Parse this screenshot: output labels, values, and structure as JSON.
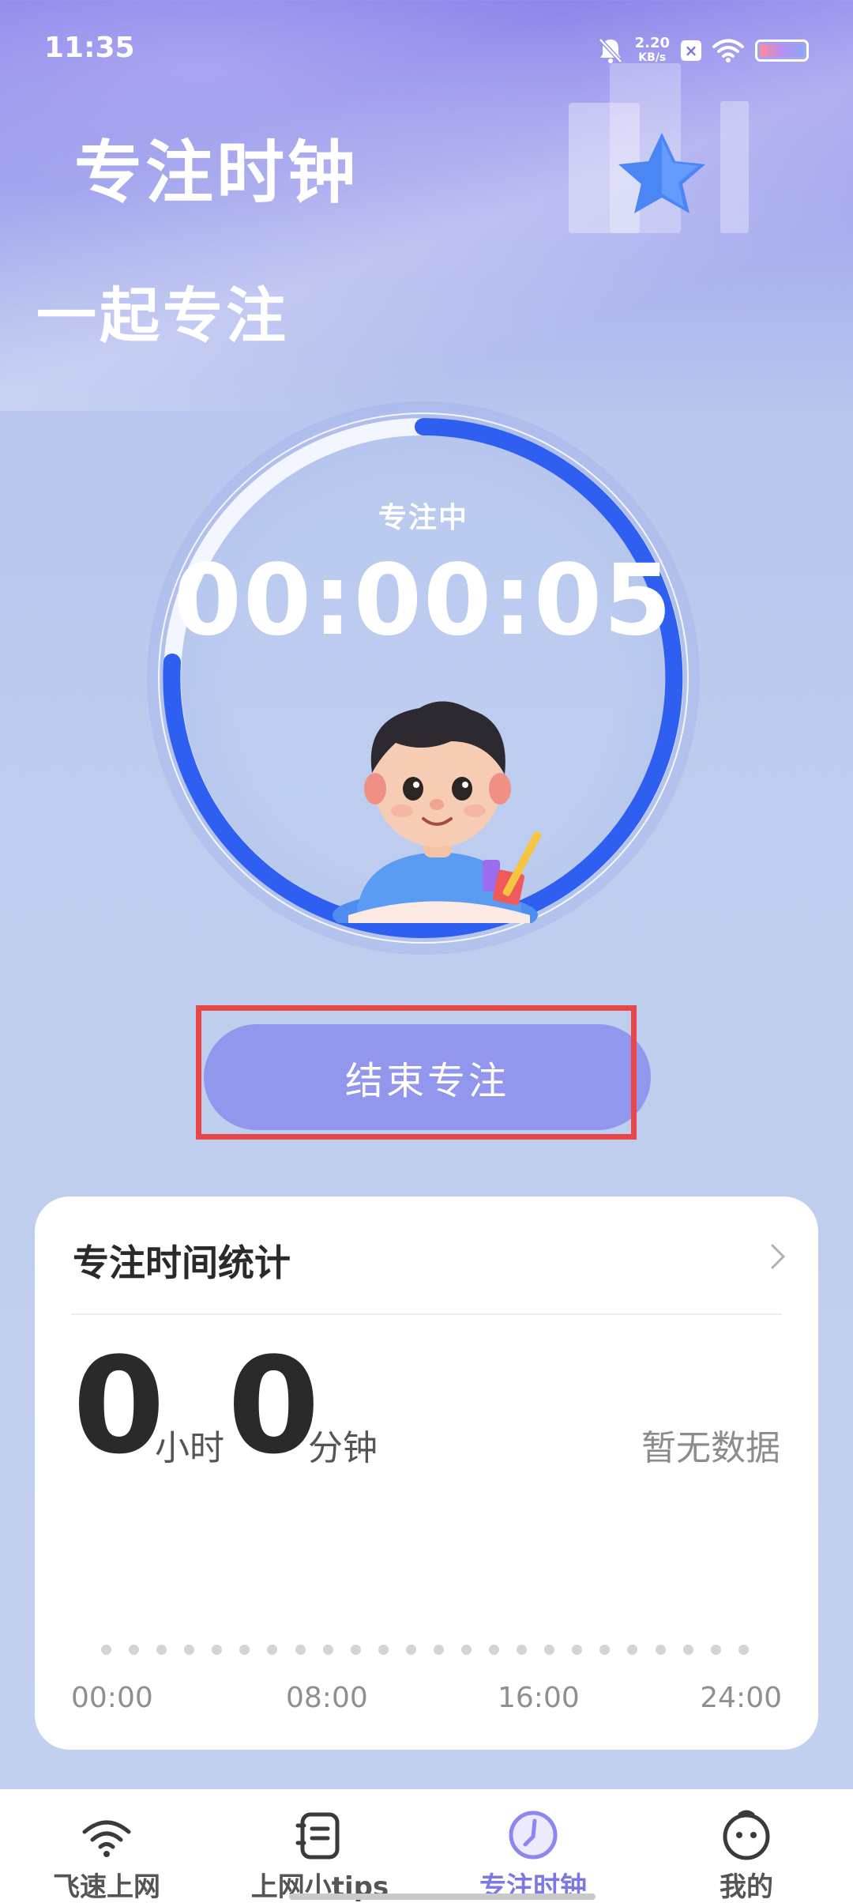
{
  "status_bar": {
    "time": "11:35",
    "net_speed_value": "2.20",
    "net_speed_unit": "KB/s",
    "icons": [
      "mute-bell-icon",
      "close-box-icon",
      "wifi-icon",
      "battery-icon"
    ]
  },
  "header": {
    "title": "专注时钟",
    "subtitle": "一起专注"
  },
  "timer": {
    "status": "专注中",
    "elapsed": "00:00:05"
  },
  "end_button_label": "结束专注",
  "stats": {
    "title": "专注时间统计",
    "hours_value": "0",
    "hours_unit": "小时",
    "minutes_value": "0",
    "minutes_unit": "分钟",
    "empty_text": "暂无数据",
    "axis_labels": [
      "00:00",
      "08:00",
      "16:00",
      "24:00"
    ]
  },
  "bottom_nav": [
    {
      "label": "飞速上网",
      "icon": "wifi-icon",
      "active": false
    },
    {
      "label": "上网小tips",
      "icon": "notepad-icon",
      "active": false
    },
    {
      "label": "专注时钟",
      "icon": "clock-icon",
      "active": true
    },
    {
      "label": "我的",
      "icon": "face-icon",
      "active": false
    }
  ],
  "colors": {
    "accent": "#7b78e4",
    "ring_progress": "#2f5ff0",
    "button_bg": "#9296ec",
    "highlight": "#e8474a"
  }
}
